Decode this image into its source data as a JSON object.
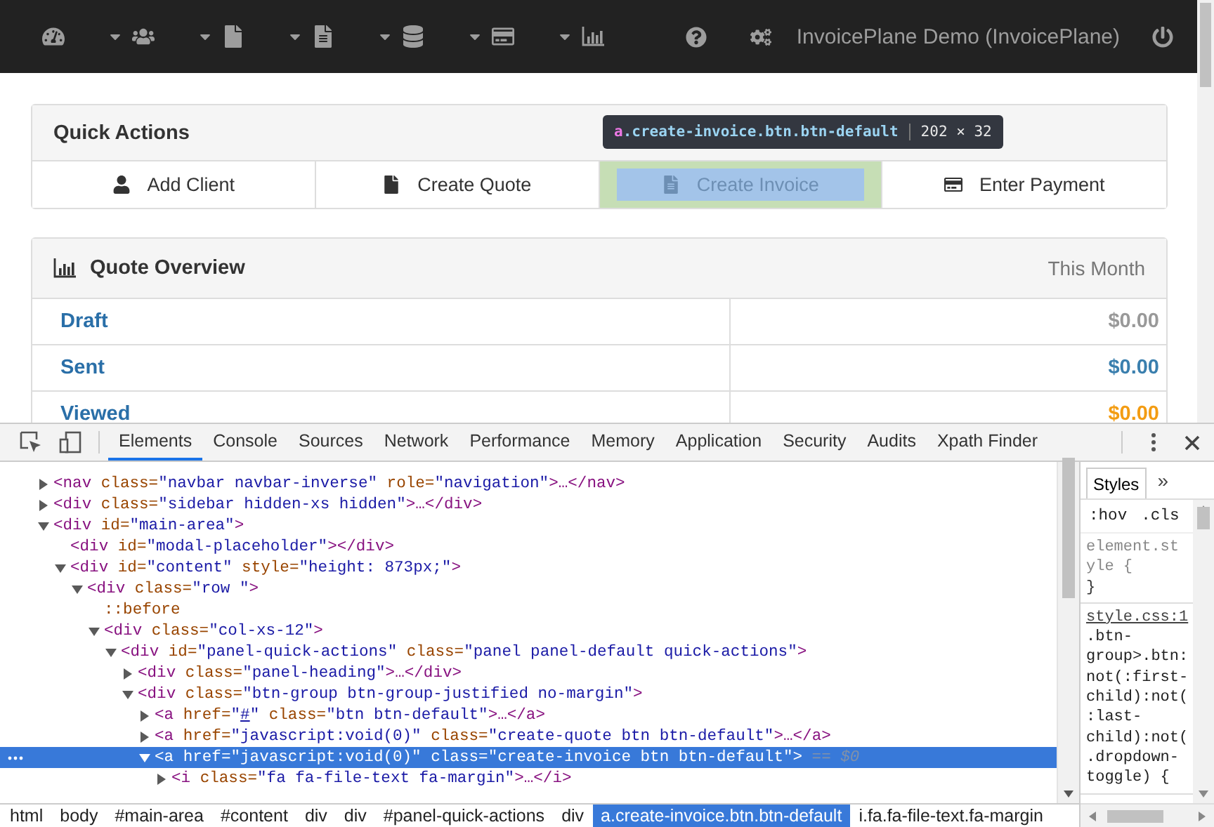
{
  "navbar": {
    "menus": [
      {
        "kind": "gauge",
        "caret": false
      },
      {
        "kind": "users",
        "caret": true
      },
      {
        "kind": "file",
        "caret": true
      },
      {
        "kind": "document",
        "caret": true
      },
      {
        "kind": "database",
        "caret": true
      },
      {
        "kind": "card",
        "caret": true
      },
      {
        "kind": "chart",
        "caret": true
      }
    ],
    "title": "InvoicePlane Demo (InvoicePlane)"
  },
  "quick_actions": {
    "title": "Quick Actions",
    "buttons": [
      {
        "kind": "user",
        "label": "Add Client",
        "selected": false
      },
      {
        "kind": "file",
        "label": "Create Quote",
        "selected": false
      },
      {
        "kind": "document",
        "label": "Create Invoice",
        "selected": true
      },
      {
        "kind": "card",
        "label": "Enter Payment",
        "selected": false
      }
    ],
    "tooltip": {
      "tag": "a",
      "classes": ".create-invoice.btn.btn-default",
      "size": "202 × 32"
    }
  },
  "quote_overview": {
    "title": "Quote Overview",
    "period": "This Month",
    "rows": [
      {
        "label": "Draft",
        "amount": "$0.00",
        "color": "#999999"
      },
      {
        "label": "Sent",
        "amount": "$0.00",
        "color": "#3a7fae"
      },
      {
        "label": "Viewed",
        "amount": "$0.00",
        "color": "#f39c12"
      }
    ]
  },
  "devtools": {
    "tabs": [
      {
        "label": "Elements",
        "selected": true
      },
      {
        "label": "Console",
        "selected": false
      },
      {
        "label": "Sources",
        "selected": false
      },
      {
        "label": "Network",
        "selected": false
      },
      {
        "label": "Performance",
        "selected": false
      },
      {
        "label": "Memory",
        "selected": false
      },
      {
        "label": "Application",
        "selected": false
      },
      {
        "label": "Security",
        "selected": false
      },
      {
        "label": "Audits",
        "selected": false
      },
      {
        "label": "Xpath Finder",
        "selected": false
      }
    ],
    "dom": [
      {
        "selected": false,
        "expanded": false,
        "tokens": [
          {
            "kind": "tag",
            "text": "<nav"
          },
          {
            "kind": "attr",
            "text": " class="
          },
          {
            "kind": "value",
            "text": "\"navbar navbar-inverse\""
          },
          {
            "kind": "attr",
            "text": " role="
          },
          {
            "kind": "value",
            "text": "\"navigation\""
          },
          {
            "kind": "tag",
            "text": ">…</nav>"
          }
        ]
      },
      {
        "selected": false,
        "expanded": false,
        "tokens": [
          {
            "kind": "tag",
            "text": "<div"
          },
          {
            "kind": "attr",
            "text": " class="
          },
          {
            "kind": "value",
            "text": "\"sidebar hidden-xs hidden\""
          },
          {
            "kind": "tag",
            "text": ">…</div>"
          }
        ]
      },
      {
        "selected": false,
        "expanded": true,
        "tokens": [
          {
            "kind": "tag",
            "text": "<div"
          },
          {
            "kind": "attr",
            "text": " id="
          },
          {
            "kind": "value",
            "text": "\"main-area\""
          },
          {
            "kind": "tag",
            "text": ">"
          }
        ],
        "children": [
          {
            "selected": false,
            "tokens": [
              {
                "kind": "tag",
                "text": "<div"
              },
              {
                "kind": "attr",
                "text": " id="
              },
              {
                "kind": "value",
                "text": "\"modal-placeholder\""
              },
              {
                "kind": "tag",
                "text": "></div>"
              }
            ]
          },
          {
            "selected": false,
            "expanded": true,
            "tokens": [
              {
                "kind": "tag",
                "text": "<div"
              },
              {
                "kind": "attr",
                "text": " id="
              },
              {
                "kind": "value",
                "text": "\"content\""
              },
              {
                "kind": "attr",
                "text": " style="
              },
              {
                "kind": "value",
                "text": "\"height: 873px;\""
              },
              {
                "kind": "tag",
                "text": ">"
              }
            ],
            "children": [
              {
                "selected": false,
                "expanded": true,
                "tokens": [
                  {
                    "kind": "tag",
                    "text": "<div"
                  },
                  {
                    "kind": "attr",
                    "text": " class="
                  },
                  {
                    "kind": "value",
                    "text": "\"row \""
                  },
                  {
                    "kind": "tag",
                    "text": ">"
                  }
                ],
                "children": [
                  {
                    "selected": false,
                    "tokens": [
                      {
                        "kind": "pseudo",
                        "text": "::before"
                      }
                    ]
                  },
                  {
                    "selected": false,
                    "expanded": true,
                    "tokens": [
                      {
                        "kind": "tag",
                        "text": "<div"
                      },
                      {
                        "kind": "attr",
                        "text": " class="
                      },
                      {
                        "kind": "value",
                        "text": "\"col-xs-12\""
                      },
                      {
                        "kind": "tag",
                        "text": ">"
                      }
                    ],
                    "children": [
                      {
                        "selected": false,
                        "expanded": true,
                        "tokens": [
                          {
                            "kind": "tag",
                            "text": "<div"
                          },
                          {
                            "kind": "attr",
                            "text": " id="
                          },
                          {
                            "kind": "value",
                            "text": "\"panel-quick-actions\""
                          },
                          {
                            "kind": "attr",
                            "text": " class="
                          },
                          {
                            "kind": "value",
                            "text": "\"panel panel-default quick-actions\""
                          },
                          {
                            "kind": "tag",
                            "text": ">"
                          }
                        ],
                        "children": [
                          {
                            "selected": false,
                            "expanded": false,
                            "tokens": [
                              {
                                "kind": "tag",
                                "text": "<div"
                              },
                              {
                                "kind": "attr",
                                "text": " class="
                              },
                              {
                                "kind": "value",
                                "text": "\"panel-heading\""
                              },
                              {
                                "kind": "tag",
                                "text": ">…</div>"
                              }
                            ]
                          },
                          {
                            "selected": false,
                            "expanded": true,
                            "tokens": [
                              {
                                "kind": "tag",
                                "text": "<div"
                              },
                              {
                                "kind": "attr",
                                "text": " class="
                              },
                              {
                                "kind": "value",
                                "text": "\"btn-group btn-group-justified no-margin\""
                              },
                              {
                                "kind": "tag",
                                "text": ">"
                              }
                            ],
                            "children": [
                              {
                                "selected": false,
                                "expanded": false,
                                "tokens": [
                                  {
                                    "kind": "tag",
                                    "text": "<a"
                                  },
                                  {
                                    "kind": "attr",
                                    "text": " href="
                                  },
                                  {
                                    "kind": "value",
                                    "text": "\""
                                  },
                                  {
                                    "kind": "link",
                                    "text": "#"
                                  },
                                  {
                                    "kind": "value",
                                    "text": "\""
                                  },
                                  {
                                    "kind": "attr",
                                    "text": " class="
                                  },
                                  {
                                    "kind": "value",
                                    "text": "\"btn btn-default\""
                                  },
                                  {
                                    "kind": "tag",
                                    "text": ">…</a>"
                                  }
                                ]
                              },
                              {
                                "selected": false,
                                "expanded": false,
                                "tokens": [
                                  {
                                    "kind": "tag",
                                    "text": "<a"
                                  },
                                  {
                                    "kind": "attr",
                                    "text": " href="
                                  },
                                  {
                                    "kind": "value",
                                    "text": "\"javascript:void(0)\""
                                  },
                                  {
                                    "kind": "attr",
                                    "text": " class="
                                  },
                                  {
                                    "kind": "value",
                                    "text": "\"create-quote btn btn-default\""
                                  },
                                  {
                                    "kind": "tag",
                                    "text": ">…</a>"
                                  }
                                ]
                              },
                              {
                                "selected": true,
                                "expanded": true,
                                "tokens": [
                                  {
                                    "kind": "tag",
                                    "text": "<a"
                                  },
                                  {
                                    "kind": "attr",
                                    "text": " href="
                                  },
                                  {
                                    "kind": "value",
                                    "text": "\"javascript:void(0)\""
                                  },
                                  {
                                    "kind": "attr",
                                    "text": " class="
                                  },
                                  {
                                    "kind": "value",
                                    "text": "\"create-invoice btn btn-default\""
                                  },
                                  {
                                    "kind": "tag",
                                    "text": ">"
                                  },
                                  {
                                    "kind": "marker",
                                    "text": " == $0"
                                  }
                                ],
                                "children": [
                                  {
                                    "selected": false,
                                    "expanded": false,
                                    "tokens": [
                                      {
                                        "kind": "tag",
                                        "text": "<i"
                                      },
                                      {
                                        "kind": "attr",
                                        "text": " class="
                                      },
                                      {
                                        "kind": "value",
                                        "text": "\"fa fa-file-text fa-margin\""
                                      },
                                      {
                                        "kind": "tag",
                                        "text": ">…</i>"
                                      }
                                    ]
                                  }
                                ]
                              }
                            ]
                          }
                        ]
                      }
                    ]
                  }
                ]
              }
            ]
          }
        ]
      }
    ],
    "breadcrumbs": [
      {
        "label": "html",
        "selected": false
      },
      {
        "label": "body",
        "selected": false
      },
      {
        "label": "#main-area",
        "selected": false
      },
      {
        "label": "#content",
        "selected": false
      },
      {
        "label": "div",
        "selected": false
      },
      {
        "label": "div",
        "selected": false
      },
      {
        "label": "#panel-quick-actions",
        "selected": false
      },
      {
        "label": "div",
        "selected": false
      },
      {
        "label": "a.create-invoice.btn.btn-default",
        "selected": true
      },
      {
        "label": "i.fa.fa-file-text.fa-margin",
        "selected": false
      }
    ],
    "styles": {
      "tab": "Styles",
      "more": "»",
      "filters": [
        ":hov",
        ".cls"
      ],
      "element_style": {
        "open": "element.style {",
        "close": "}"
      },
      "rule": {
        "source": "style.css:1",
        "selector": ".btn-group>.btn:not(:first-child):not(:last-child):not(.dropdown-toggle) {"
      }
    }
  }
}
